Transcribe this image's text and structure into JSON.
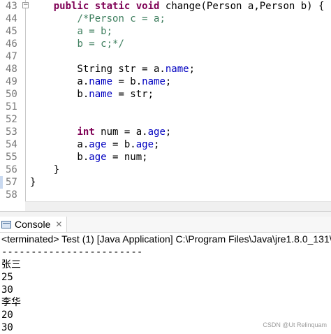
{
  "editor": {
    "lines": [
      {
        "num": "43",
        "tokens": [
          {
            "t": "    ",
            "c": "pl"
          },
          {
            "t": "public",
            "c": "kw"
          },
          {
            "t": " ",
            "c": "pl"
          },
          {
            "t": "static",
            "c": "kw"
          },
          {
            "t": " ",
            "c": "pl"
          },
          {
            "t": "void",
            "c": "kw"
          },
          {
            "t": " change(Person a,Person b) {",
            "c": "pl"
          }
        ]
      },
      {
        "num": "44",
        "tokens": [
          {
            "t": "        ",
            "c": "pl"
          },
          {
            "t": "/*Person c = a;",
            "c": "cm"
          }
        ]
      },
      {
        "num": "45",
        "tokens": [
          {
            "t": "        ",
            "c": "pl"
          },
          {
            "t": "a = b;",
            "c": "cm"
          }
        ]
      },
      {
        "num": "46",
        "tokens": [
          {
            "t": "        ",
            "c": "pl"
          },
          {
            "t": "b = c;*/",
            "c": "cm"
          }
        ]
      },
      {
        "num": "47",
        "tokens": []
      },
      {
        "num": "48",
        "tokens": [
          {
            "t": "        String str = a.",
            "c": "pl"
          },
          {
            "t": "name",
            "c": "fd"
          },
          {
            "t": ";",
            "c": "pl"
          }
        ]
      },
      {
        "num": "49",
        "tokens": [
          {
            "t": "        a.",
            "c": "pl"
          },
          {
            "t": "name",
            "c": "fd"
          },
          {
            "t": " = b.",
            "c": "pl"
          },
          {
            "t": "name",
            "c": "fd"
          },
          {
            "t": ";",
            "c": "pl"
          }
        ]
      },
      {
        "num": "50",
        "tokens": [
          {
            "t": "        b.",
            "c": "pl"
          },
          {
            "t": "name",
            "c": "fd"
          },
          {
            "t": " = str;",
            "c": "pl"
          }
        ]
      },
      {
        "num": "51",
        "tokens": []
      },
      {
        "num": "52",
        "tokens": []
      },
      {
        "num": "53",
        "tokens": [
          {
            "t": "        ",
            "c": "pl"
          },
          {
            "t": "int",
            "c": "kw"
          },
          {
            "t": " num = a.",
            "c": "pl"
          },
          {
            "t": "age",
            "c": "fd"
          },
          {
            "t": ";",
            "c": "pl"
          }
        ]
      },
      {
        "num": "54",
        "tokens": [
          {
            "t": "        a.",
            "c": "pl"
          },
          {
            "t": "age",
            "c": "fd"
          },
          {
            "t": " = b.",
            "c": "pl"
          },
          {
            "t": "age",
            "c": "fd"
          },
          {
            "t": ";",
            "c": "pl"
          }
        ]
      },
      {
        "num": "55",
        "tokens": [
          {
            "t": "        b.",
            "c": "pl"
          },
          {
            "t": "age",
            "c": "fd"
          },
          {
            "t": " = num;",
            "c": "pl"
          }
        ]
      },
      {
        "num": "56",
        "tokens": [
          {
            "t": "    }",
            "c": "pl"
          }
        ]
      },
      {
        "num": "57",
        "tokens": [
          {
            "t": "}",
            "c": "pl"
          }
        ]
      },
      {
        "num": "58",
        "tokens": []
      }
    ]
  },
  "console": {
    "tab_label": "Console",
    "tab_close": "✕",
    "status": "<terminated> Test (1) [Java Application] C:\\Program Files\\Java\\jre1.8.0_131\\",
    "output": [
      "------------------------",
      "张三",
      "25",
      "30",
      "李华",
      "20",
      "30"
    ]
  },
  "watermark": "CSDN @Ut Relinquam",
  "colors": {
    "keyword": "#7f0055",
    "comment": "#3f7f5f",
    "field": "#0000c0",
    "line_number": "#787878"
  }
}
